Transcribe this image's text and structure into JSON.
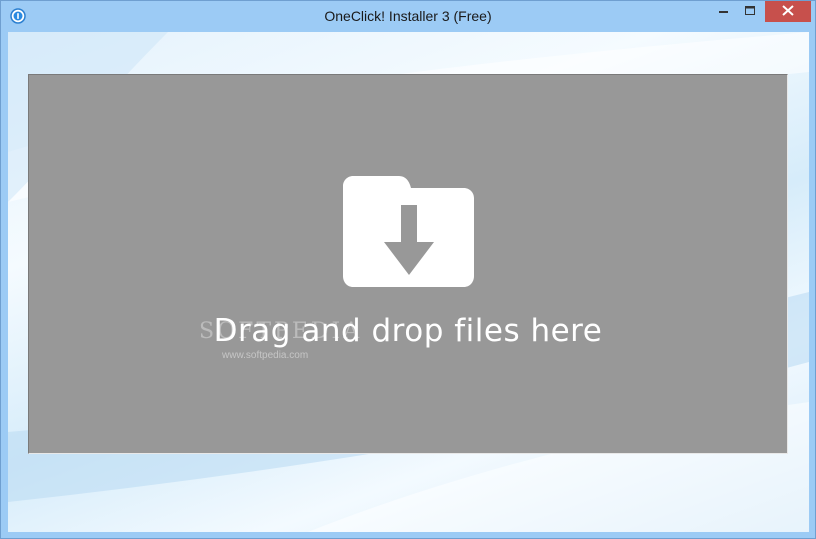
{
  "window": {
    "title": "OneClick! Installer 3 (Free)",
    "app_icon": "app-info-icon",
    "controls": {
      "minimize_icon": "minimize-icon",
      "maximize_icon": "maximize-icon",
      "close_icon": "close-icon",
      "close_color": "#c7504c"
    }
  },
  "dropzone": {
    "icon": "folder-download-icon",
    "text": "Drag and drop files here",
    "background_color": "#989898"
  },
  "watermark": {
    "brand": "SOFTPEDIA",
    "url": "www.softpedia.com"
  }
}
